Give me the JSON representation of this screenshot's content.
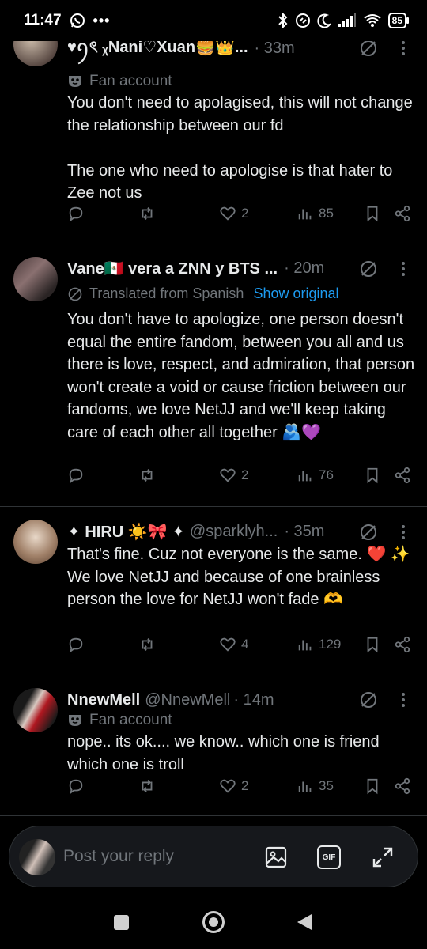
{
  "status_bar": {
    "time": "11:47",
    "battery": "85",
    "icons": [
      "whatsapp-icon",
      "more-dots-icon",
      "bluetooth-icon",
      "link-icon",
      "moon-icon",
      "signal-icon",
      "wifi-icon",
      "battery-icon"
    ]
  },
  "tweets": [
    {
      "name": "♥︎ꪆৎ ᵪNani♡Xuan🍔👑...",
      "handle": "",
      "time": "· 33m",
      "label": "Fan account",
      "text": "You don't need to apolagised, this will not change the relationship between our fd\n\nThe one who need to apologise is that hater to Zee not us",
      "likes": "2",
      "views": "85"
    },
    {
      "name": "Vane🇲🇽 vera a ZNN y BTS ...",
      "handle": "",
      "time": "· 20m",
      "translated": "Translated from Spanish",
      "show_original": "Show original",
      "text": "You don't have to apologize, one person doesn't equal the entire fandom, between you all and us there is love, respect, and admiration, that person won't create a void or cause friction between our fandoms, we love NetJJ and we'll keep taking care of each other all together 🫂💜",
      "likes": "2",
      "views": "76"
    },
    {
      "name": "✦ HIRU ☀️🎀 ✦",
      "handle": "@sparklyh...",
      "time": "· 35m",
      "text": "That's fine. Cuz not everyone is the same. ❤️ ✨ We love NetJJ and because of one brainless person the love for NetJJ won't fade 🫶",
      "likes": "4",
      "views": "129"
    },
    {
      "name": "NnewMell",
      "handle": "@NnewMell",
      "time": "· 14m",
      "label": "Fan account",
      "text": "nope.. its ok.... we know.. which one is friend which one is troll",
      "likes": "2",
      "views": "35"
    }
  ],
  "composer": {
    "placeholder": "Post your reply",
    "gif_label": "GIF"
  },
  "colors": {
    "background": "#000000",
    "text": "#e7e9ea",
    "muted": "#71767b",
    "link": "#1d9bf0",
    "divider": "#2f3336"
  }
}
